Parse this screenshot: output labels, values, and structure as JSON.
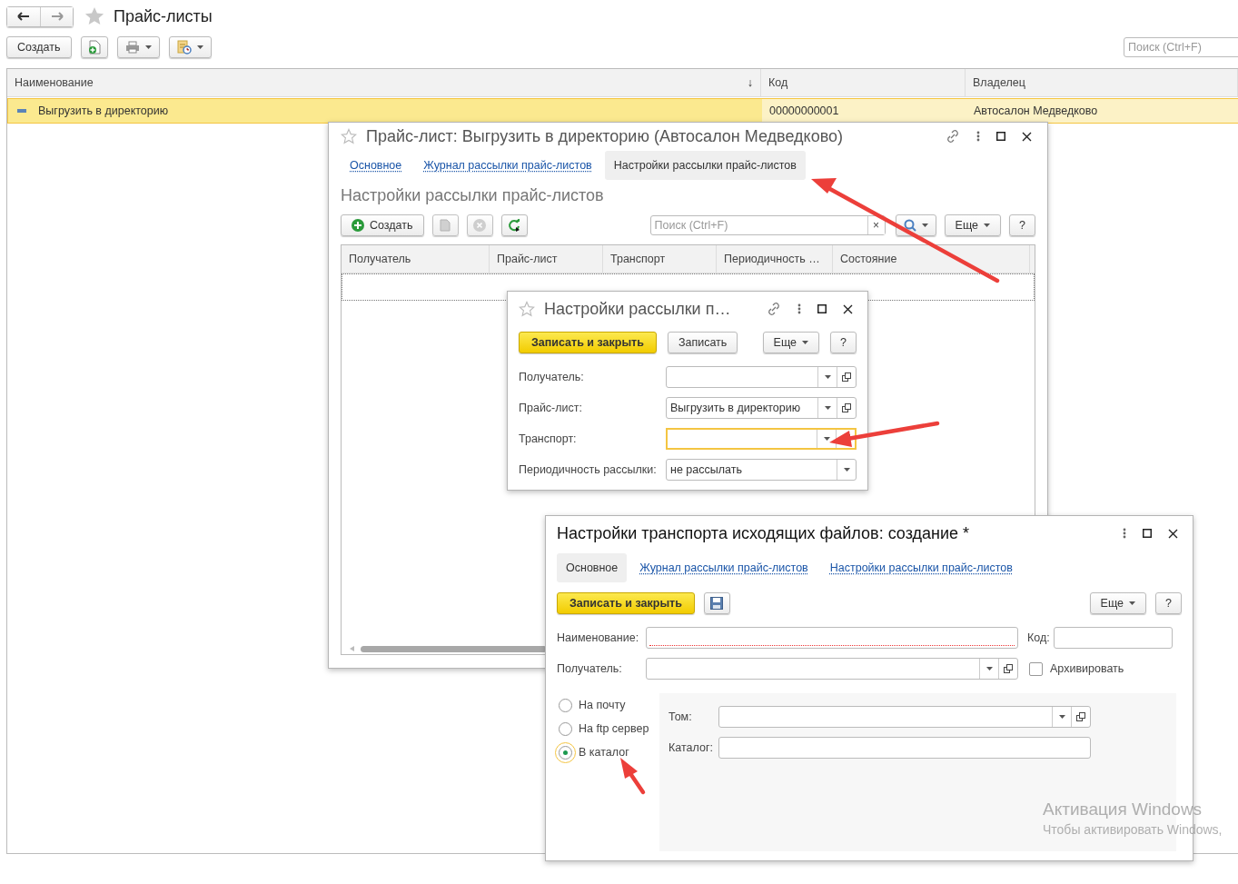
{
  "page": {
    "title": "Прайс-листы",
    "create_button": "Создать",
    "search": {
      "placeholder": "Поиск (Ctrl+F)"
    }
  },
  "table": {
    "columns": [
      {
        "label": "Наименование",
        "sort": "↓"
      },
      {
        "label": "Код"
      },
      {
        "label": "Владелец"
      }
    ],
    "rows": [
      {
        "cells": [
          "Выгрузить в директорию",
          "00000000001",
          "Автосалон Медведково"
        ],
        "selected": true
      }
    ]
  },
  "price_list_window": {
    "title": "Прайс-лист: Выгрузить в директорию (Автосалон Медведково)",
    "tabs": [
      {
        "label": "Основное",
        "selected": false
      },
      {
        "label": "Журнал рассылки прайс-листов",
        "selected": false
      },
      {
        "label": "Настройки рассылки прайс-листов",
        "selected": true
      }
    ],
    "section_title": "Настройки рассылки прайс-листов",
    "toolbar": {
      "create": "Создать",
      "search_placeholder": "Поиск (Ctrl+F)",
      "clear": "×",
      "more": "Еще",
      "help": "?"
    },
    "columns": [
      "Получатель",
      "Прайс-лист",
      "Транспорт",
      "Периодичность …",
      "Состояние"
    ]
  },
  "settings_window": {
    "title": "Настройки рассылки п…",
    "buttons": {
      "save_close": "Записать и закрыть",
      "save": "Записать",
      "more": "Еще",
      "help": "?"
    },
    "fields": [
      {
        "label": "Получатель:",
        "kind": "select_open",
        "focused": false
      },
      {
        "label": "Прайс-лист:",
        "value": "Выгрузить в директорию",
        "kind": "select_open",
        "focused": false
      },
      {
        "label": "Транспорт:",
        "kind": "select_open",
        "focused": true
      },
      {
        "label": "Периодичность рассылки:",
        "value": "не рассылать",
        "kind": "select",
        "focused": false
      }
    ]
  },
  "transport_window": {
    "title": "Настройки транспорта исходящих файлов: создание *",
    "tabs": [
      {
        "label": "Основное",
        "selected": true
      },
      {
        "label": "Журнал рассылки прайс-листов",
        "selected": false
      },
      {
        "label": "Настройки рассылки прайс-листов",
        "selected": false
      }
    ],
    "buttons": {
      "save_close": "Записать и закрыть",
      "more": "Еще",
      "help": "?"
    },
    "name_field": {
      "label": "Наименование:",
      "required": true
    },
    "code_field": {
      "label": "Код:"
    },
    "recipient_field": {
      "label": "Получатель:"
    },
    "archive": {
      "label": "Архивировать",
      "checked": false
    },
    "methods": [
      {
        "label": "На почту",
        "selected": false
      },
      {
        "label": "На ftp сервер",
        "selected": false
      },
      {
        "label": "В каталог",
        "selected": true
      }
    ],
    "volume_field": {
      "label": "Том:"
    },
    "folder_field": {
      "label": "Каталог:"
    }
  },
  "os_notice": {
    "title": "Активация Windows",
    "text": "Чтобы активировать Windows,"
  }
}
